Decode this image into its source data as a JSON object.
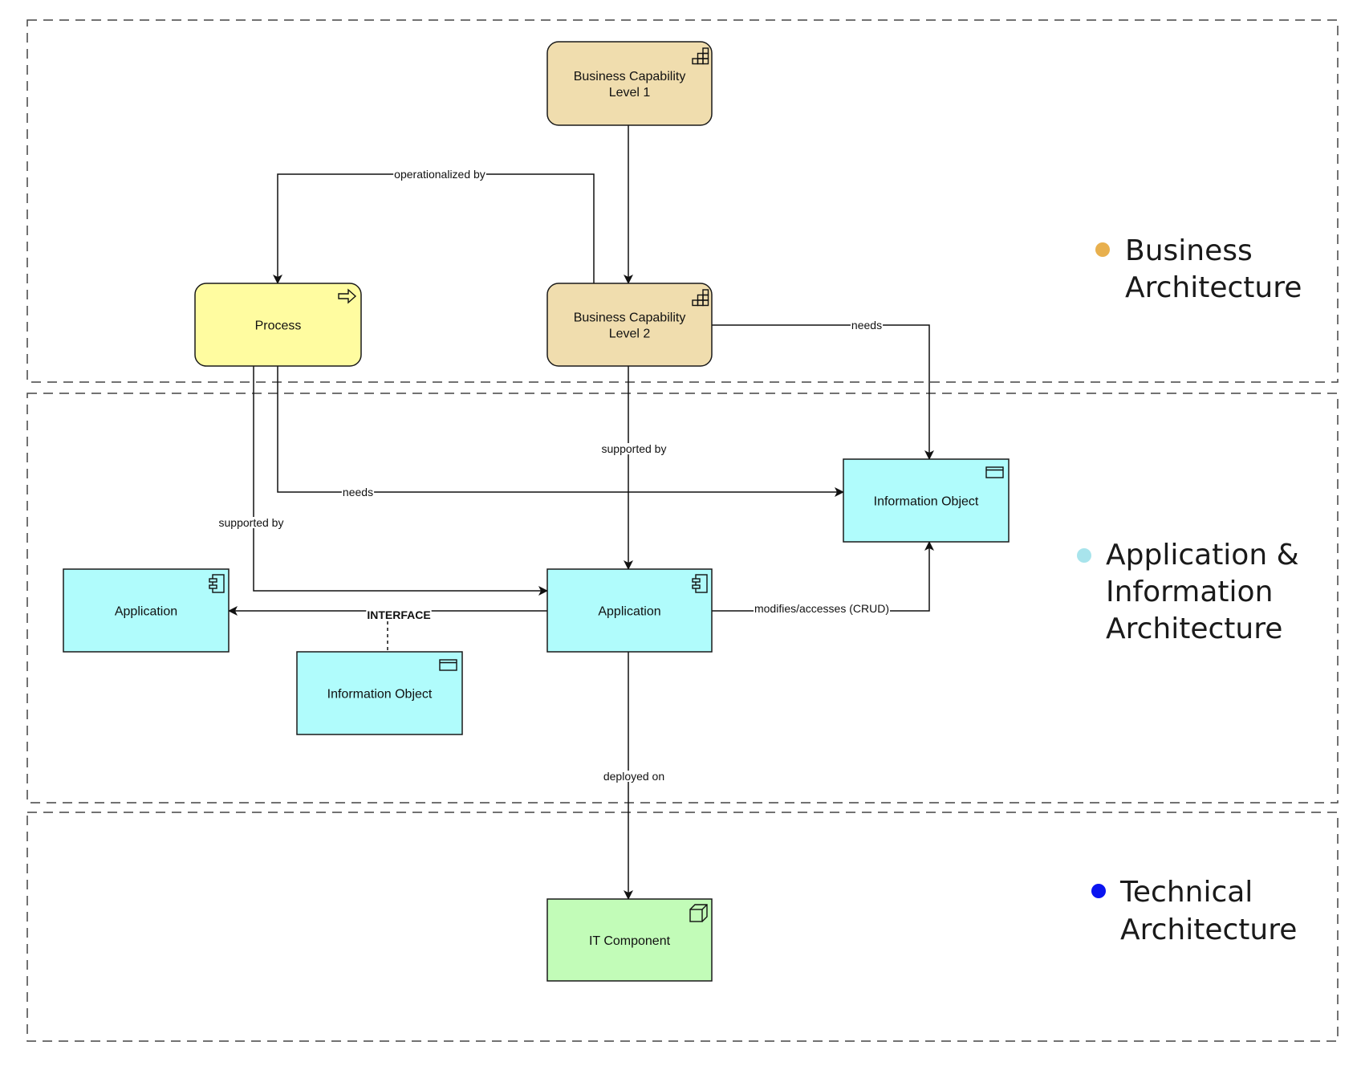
{
  "lanes": [
    {
      "id": "business",
      "title_lines": [
        "Business",
        "Architecture"
      ],
      "dot_color": "#E8B04E"
    },
    {
      "id": "application",
      "title_lines": [
        "Application &",
        "Information",
        "Architecture"
      ],
      "dot_color": "#A8E4EC"
    },
    {
      "id": "technical",
      "title_lines": [
        "Technical",
        "Architecture"
      ],
      "dot_color": "#0A14F0"
    }
  ],
  "colors": {
    "capability": "#F0DDAE",
    "process": "#FFFCA0",
    "application": "#B0FCFC",
    "it_component": "#C2FCB8",
    "stroke": "#1a1a1a",
    "lane_border": "#444444"
  },
  "nodes": {
    "bc1": {
      "lines": [
        "Business Capability",
        "Level 1"
      ],
      "icon": "capability-icon"
    },
    "bc2": {
      "lines": [
        "Business Capability",
        "Level 2"
      ],
      "icon": "capability-icon"
    },
    "process": {
      "lines": [
        "Process"
      ],
      "icon": "process-arrow-icon"
    },
    "info_right": {
      "lines": [
        "Information Object"
      ],
      "icon": "information-object-icon"
    },
    "app_left": {
      "lines": [
        "Application"
      ],
      "icon": "component-icon"
    },
    "app_center": {
      "lines": [
        "Application"
      ],
      "icon": "component-icon"
    },
    "info_bottom": {
      "lines": [
        "Information Object"
      ],
      "icon": "information-object-icon"
    },
    "it_component": {
      "lines": [
        "IT Component"
      ],
      "icon": "node-cube-icon"
    }
  },
  "edges": {
    "bc1_bc2": {
      "label": ""
    },
    "operationalized": {
      "label": "operationalized by"
    },
    "bc2_needs": {
      "label": "needs"
    },
    "bc2_supported": {
      "label": "supported by"
    },
    "process_needs": {
      "label": "needs"
    },
    "process_supported": {
      "label": "supported by"
    },
    "interface": {
      "label": "INTERFACE"
    },
    "crud": {
      "label": "modifies/accesses (CRUD)"
    },
    "deployed": {
      "label": "deployed on"
    }
  }
}
